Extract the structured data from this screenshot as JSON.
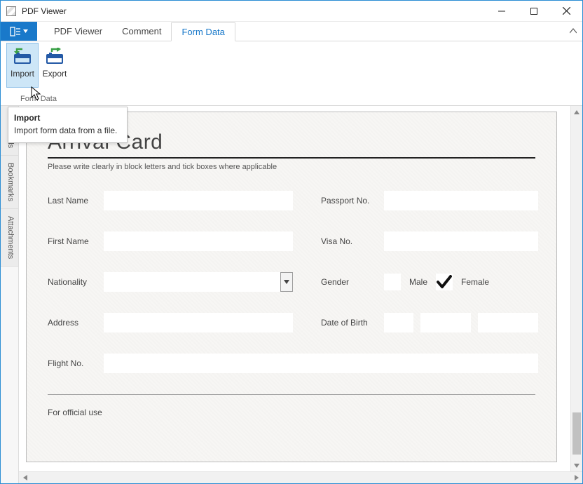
{
  "window": {
    "title": "PDF Viewer"
  },
  "tabs": {
    "pdf_viewer": "PDF Viewer",
    "comment": "Comment",
    "form_data": "Form Data"
  },
  "ribbon": {
    "import": "Import",
    "export": "Export",
    "group_label": "Form Data"
  },
  "tooltip": {
    "title": "Import",
    "body": "Import form data from a file."
  },
  "sidetabs": {
    "thumbnails": "humbnails",
    "bookmarks": "Bookmarks",
    "attachments": "Attachments"
  },
  "form": {
    "title": "Arrival Card",
    "instruction": "Please write clearly in block letters and tick boxes where applicable",
    "labels": {
      "last_name": "Last Name",
      "first_name": "First Name",
      "nationality": "Nationality",
      "address": "Address",
      "flight_no": "Flight No.",
      "passport_no": "Passport No.",
      "visa_no": "Visa No.",
      "gender": "Gender",
      "male": "Male",
      "female": "Female",
      "dob": "Date of Birth",
      "official_use": "For official use"
    }
  }
}
